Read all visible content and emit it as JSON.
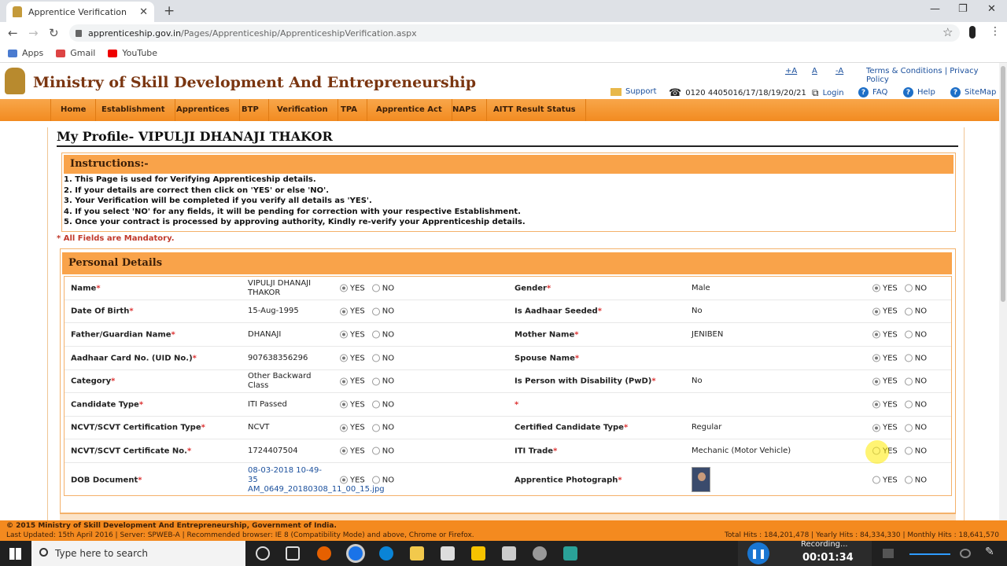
{
  "browser": {
    "tab_title": "Apprentice Verification",
    "url_host": "apprenticeship.gov.in",
    "url_path": "/Pages/Apprenticeship/ApprenticeshipVerification.aspx",
    "bookmarks": [
      "Apps",
      "Gmail",
      "YouTube"
    ],
    "new_tab": "+",
    "close": "✕",
    "minimize": "—",
    "maximize": "❐"
  },
  "site": {
    "ministry": "Ministry of Skill Development And Entrepreneurship",
    "font_controls": [
      "+A",
      "A",
      "-A"
    ],
    "terms": "Terms & Conditions",
    "sep": "|",
    "privacy": "Privacy Policy",
    "support": "Support",
    "phone": "0120 4405016/17/18/19/20/21",
    "login": "Login",
    "faq": "FAQ",
    "help": "Help",
    "sitemap": "SiteMap",
    "menu": [
      "Home",
      "Establishment",
      "Apprentices",
      "BTP",
      "Verification",
      "TPA",
      "Apprentice Act",
      "NAPS",
      "AITT Result Status"
    ]
  },
  "profile": {
    "title": "My Profile- VIPULJI DHANAJI THAKOR",
    "instructions_title": "Instructions:-",
    "instructions": [
      "1. This Page is used for Verifying Apprenticeship details.",
      "2. If your details are correct then click on 'YES' or else 'NO'.",
      "3. Your Verification will be completed if you verify all details as 'YES'.",
      "4. If you select 'NO' for any fields, it will be pending for correction with your respective Establishment.",
      "5. Once your contract is processed by approving authority, Kindly re-verify your Apprenticeship details."
    ],
    "mandatory": "* All Fields are Mandatory.",
    "section_title": "Personal Details",
    "yes": "YES",
    "no": "NO",
    "left_rows": [
      {
        "label": "Name",
        "value": "VIPULJI DHANAJI THAKOR"
      },
      {
        "label": "Date Of Birth",
        "value": "15-Aug-1995"
      },
      {
        "label": "Father/Guardian Name",
        "value": "DHANAJI"
      },
      {
        "label": "Aadhaar Card No. (UID No.)",
        "value": "907638356296"
      },
      {
        "label": "Category",
        "value": "Other Backward Class"
      },
      {
        "label": "Candidate Type",
        "value": "ITI Passed"
      },
      {
        "label": "NCVT/SCVT Certification Type",
        "value": "NCVT"
      },
      {
        "label": "NCVT/SCVT Certificate No.",
        "value": "1724407504"
      },
      {
        "label": "DOB Document",
        "value": "08-03-2018 10-49-35 AM_0649_20180308_11_00_15.jpg"
      }
    ],
    "right_rows": [
      {
        "label": "Gender",
        "value": "Male"
      },
      {
        "label": "Is Aadhaar Seeded",
        "value": "No"
      },
      {
        "label": "Mother Name",
        "value": "JENIBEN"
      },
      {
        "label": "Spouse Name",
        "value": ""
      },
      {
        "label": "Is Person with Disability (PwD)",
        "value": "No"
      },
      {
        "label": "",
        "value": ""
      },
      {
        "label": "Certified Candidate Type",
        "value": "Regular"
      },
      {
        "label": "ITI Trade",
        "value": "Mechanic (Motor Vehicle)"
      },
      {
        "label": "Apprentice Photograph",
        "value": ""
      }
    ]
  },
  "footer": {
    "copyright": "© 2015 Ministry of Skill Development And Entrepreneurship, Government of India.",
    "updated": "Last Updated: 15th April 2016 | Server: SPWEB-A | Recommended browser: IE 8 (Compatibility Mode) and above, Chrome or Firefox.",
    "hits": "Total Hits : 184,201,478 | Yearly Hits : 84,334,330 | Monthly Hits : 18,641,570"
  },
  "taskbar": {
    "search_placeholder": "Type here to search",
    "recording": "Recording...",
    "timer": "00:01:34"
  }
}
